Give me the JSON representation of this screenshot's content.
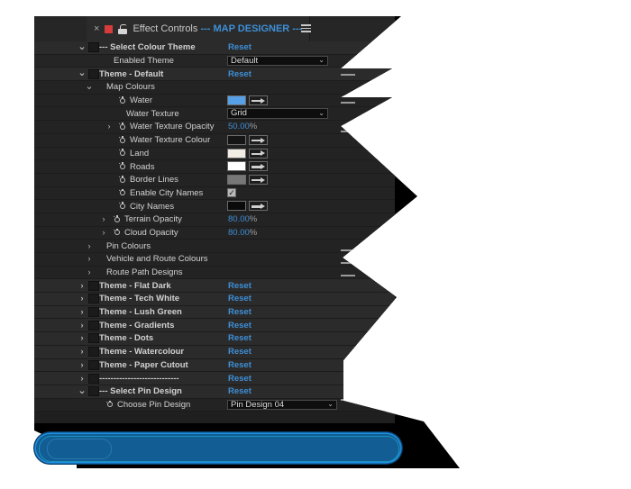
{
  "panel": {
    "tab": {
      "close_icon": "close-icon",
      "color_label": "#d83b3b",
      "lock_icon": "lock-icon",
      "title_prefix": "Effect Controls ",
      "title_highlight": "--- MAP DESIGNER ---",
      "menu_icon": "hamburger-menu-icon"
    },
    "accent_color": "#3e8fd6",
    "background": "#232323",
    "rows": [
      {
        "kind": "group",
        "twirl": "v",
        "fxbox": true,
        "indent": 66,
        "label": "--- Select Colour Theme",
        "control": "reset",
        "value": "Reset"
      },
      {
        "kind": "alt",
        "twirl": "",
        "fxbox": false,
        "indent": 82,
        "label": "Enabled Theme",
        "control": "dropdown",
        "value": "Default"
      },
      {
        "kind": "group",
        "twirl": "v",
        "fxbox": true,
        "indent": 66,
        "label": "Theme - Default",
        "control": "reset",
        "value": "Reset"
      },
      {
        "kind": "plain",
        "twirl": "v",
        "fxbox": false,
        "indent": 74,
        "label": "Map Colours",
        "control": "none",
        "value": ""
      },
      {
        "kind": "plain",
        "twirl": "",
        "fxbox": false,
        "indent": 96,
        "stopwatch": true,
        "label": "Water",
        "control": "swatch",
        "value": "#56a0e8"
      },
      {
        "kind": "plain",
        "twirl": "",
        "fxbox": false,
        "indent": 96,
        "label": "Water Texture",
        "control": "dropdown",
        "value": "Grid"
      },
      {
        "kind": "plain",
        "twirl": ">",
        "fxbox": false,
        "indent": 96,
        "stopwatch": true,
        "label": "Water Texture Opacity",
        "control": "number",
        "value": "50.00",
        "unit": "%"
      },
      {
        "kind": "plain",
        "twirl": "",
        "fxbox": false,
        "indent": 96,
        "stopwatch": true,
        "label": "Water Texture Colour",
        "control": "swatch",
        "value": "#151515"
      },
      {
        "kind": "plain",
        "twirl": "",
        "fxbox": false,
        "indent": 96,
        "stopwatch": true,
        "label": "Land",
        "control": "swatch",
        "value": "#f1ece4"
      },
      {
        "kind": "plain",
        "twirl": "",
        "fxbox": false,
        "indent": 96,
        "stopwatch": true,
        "label": "Roads",
        "control": "swatch",
        "value": "#ffffff"
      },
      {
        "kind": "plain",
        "twirl": "",
        "fxbox": false,
        "indent": 96,
        "stopwatch": true,
        "label": "Border Lines",
        "control": "swatch",
        "value": "#777777"
      },
      {
        "kind": "plain",
        "twirl": "",
        "fxbox": false,
        "indent": 96,
        "stopwatch": true,
        "label": "Enable City Names",
        "control": "checkbox",
        "value": "checked"
      },
      {
        "kind": "plain",
        "twirl": "",
        "fxbox": false,
        "indent": 96,
        "stopwatch": true,
        "label": "City Names",
        "control": "swatch",
        "value": "#0a0a0a"
      },
      {
        "kind": "plain",
        "twirl": ">",
        "fxbox": false,
        "indent": 90,
        "stopwatch": true,
        "label": "Terrain Opacity",
        "control": "number",
        "value": "80.00",
        "unit": "%"
      },
      {
        "kind": "plain",
        "twirl": ">",
        "fxbox": false,
        "indent": 90,
        "stopwatch": true,
        "label": "Cloud Opacity",
        "control": "number",
        "value": "80.00",
        "unit": "%"
      },
      {
        "kind": "plain",
        "twirl": ">",
        "fxbox": false,
        "indent": 74,
        "label": "Pin Colours",
        "control": "none",
        "value": ""
      },
      {
        "kind": "plain",
        "twirl": ">",
        "fxbox": false,
        "indent": 74,
        "label": "Vehicle and Route Colours",
        "control": "none",
        "value": ""
      },
      {
        "kind": "plain",
        "twirl": ">",
        "fxbox": false,
        "indent": 74,
        "label": "Route Path Designs",
        "control": "none",
        "value": ""
      },
      {
        "kind": "group",
        "twirl": ">",
        "fxbox": true,
        "indent": 66,
        "label": "Theme - Flat Dark",
        "control": "reset",
        "value": "Reset"
      },
      {
        "kind": "group",
        "twirl": ">",
        "fxbox": true,
        "indent": 66,
        "label": "Theme - Tech White",
        "control": "reset",
        "value": "Reset"
      },
      {
        "kind": "group",
        "twirl": ">",
        "fxbox": true,
        "indent": 66,
        "label": "Theme - Lush Green",
        "control": "reset",
        "value": "Reset"
      },
      {
        "kind": "group",
        "twirl": ">",
        "fxbox": true,
        "indent": 66,
        "label": "Theme - Gradients",
        "control": "reset",
        "value": "Reset"
      },
      {
        "kind": "group",
        "twirl": ">",
        "fxbox": true,
        "indent": 66,
        "label": "Theme - Dots",
        "control": "reset",
        "value": "Reset"
      },
      {
        "kind": "group",
        "twirl": ">",
        "fxbox": true,
        "indent": 66,
        "label": "Theme - Watercolour",
        "control": "reset",
        "value": "Reset"
      },
      {
        "kind": "group",
        "twirl": ">",
        "fxbox": true,
        "indent": 66,
        "label": "Theme - Paper Cutout",
        "control": "reset",
        "value": "Reset"
      },
      {
        "kind": "group",
        "twirl": ">",
        "fxbox": true,
        "indent": 66,
        "label": "----------------------------",
        "control": "reset",
        "value": "Reset"
      },
      {
        "kind": "group",
        "twirl": "v",
        "fxbox": true,
        "indent": 66,
        "label": "--- Select Pin Design",
        "control": "reset",
        "value": "Reset"
      },
      {
        "kind": "plain",
        "twirl": "",
        "fxbox": false,
        "indent": 82,
        "stopwatch": true,
        "label": "Choose Pin Design",
        "control": "dropdown-wide",
        "value": "Pin Design 04"
      }
    ]
  },
  "highlight": {
    "name": "selection-pill",
    "fill": "#115d94",
    "stroke": "#1f8fe0"
  }
}
